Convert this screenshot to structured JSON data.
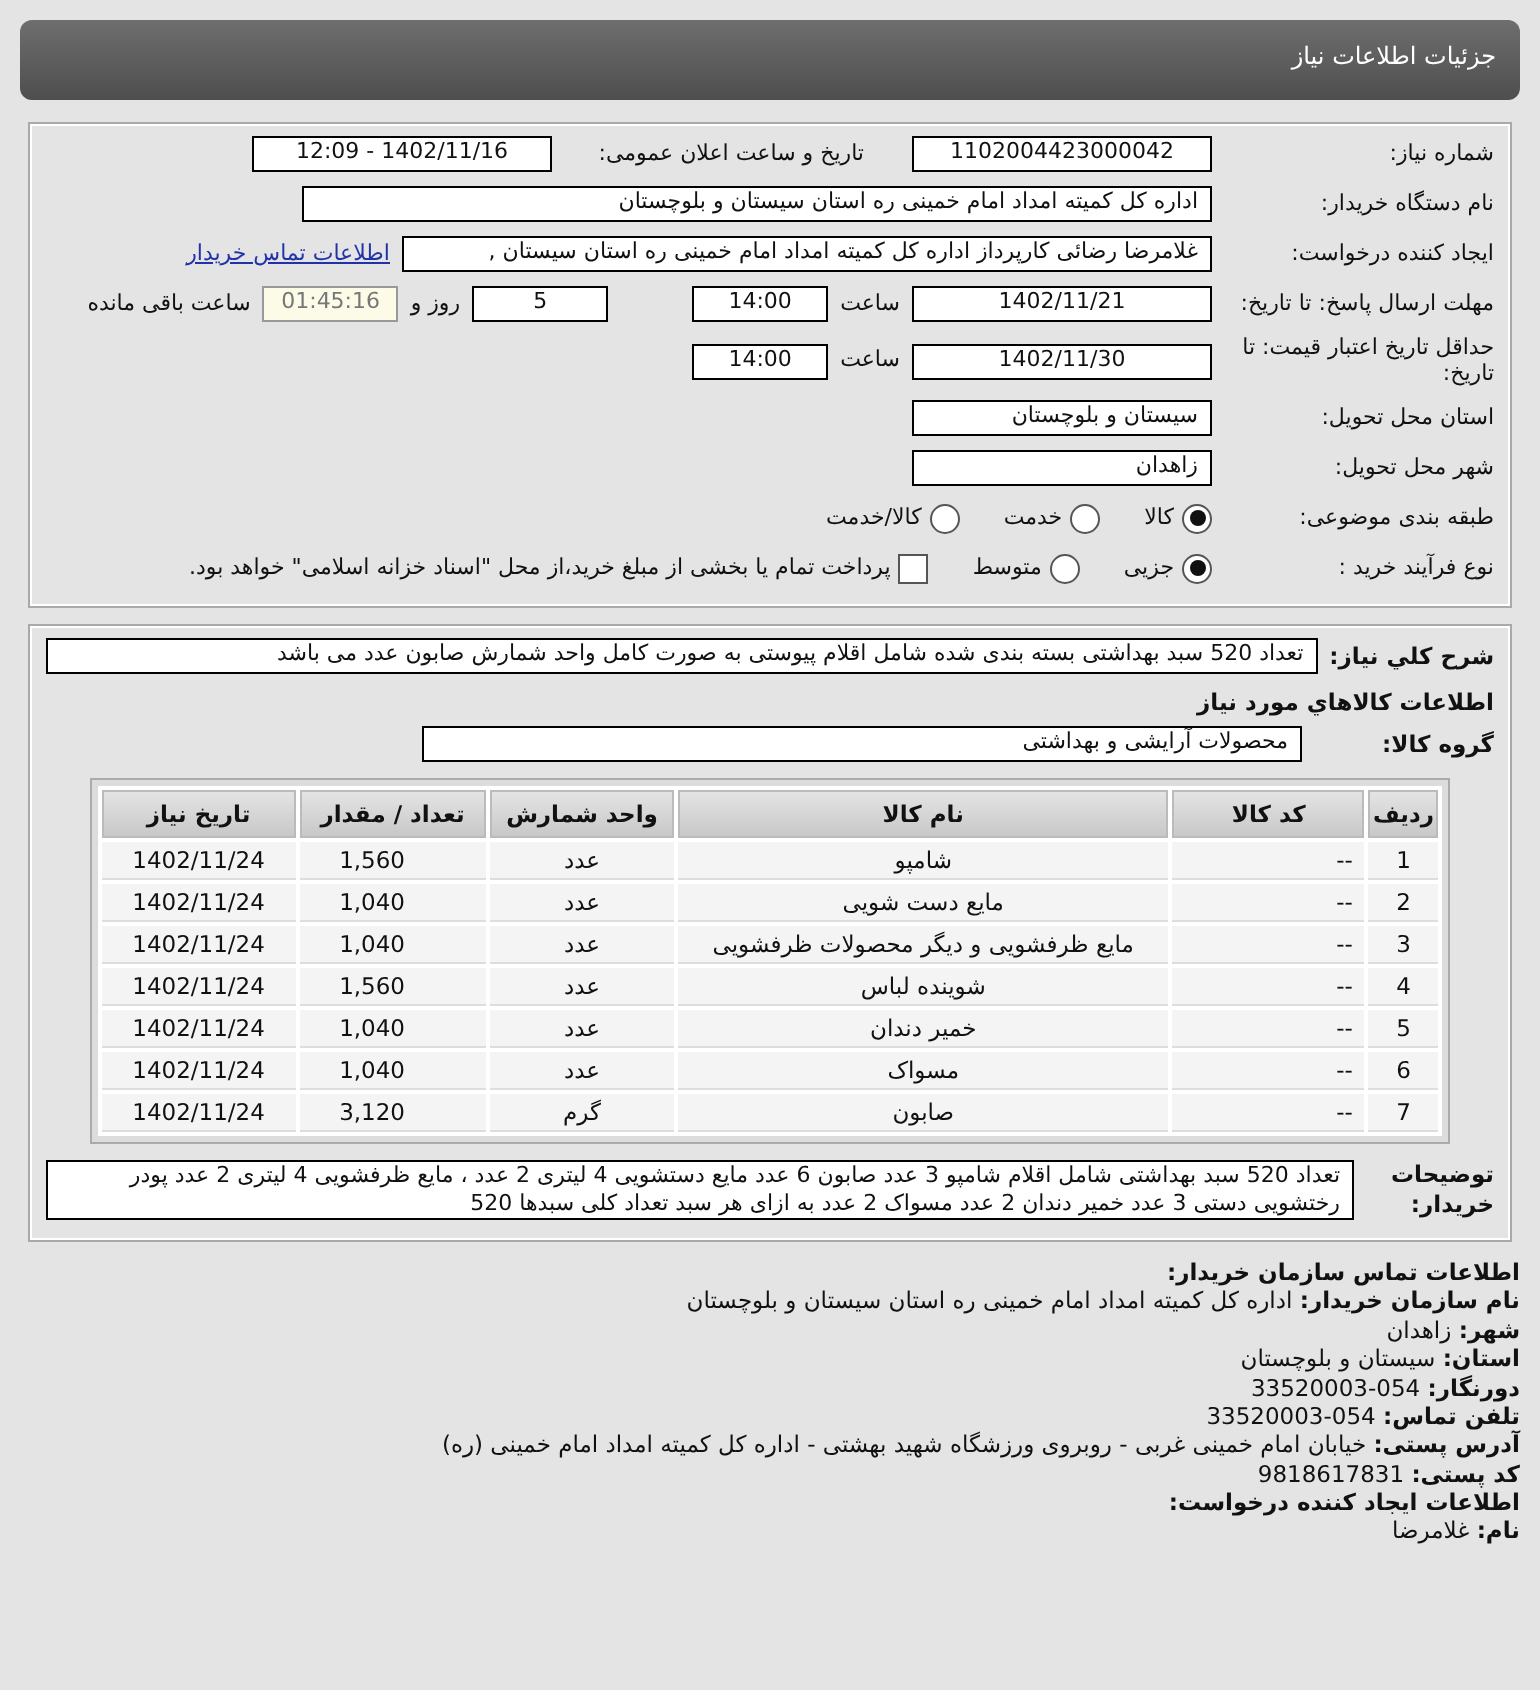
{
  "header": {
    "title": "جزئیات اطلاعات نیاز"
  },
  "need_number": {
    "label": "شماره نیاز:",
    "value": "1102004423000042"
  },
  "announce": {
    "label": "تاریخ و ساعت اعلان عمومی:",
    "value": "1402/11/16 - 12:09"
  },
  "buyer_org": {
    "label": "نام دستگاه خریدار:",
    "value": "اداره کل کمیته امداد امام خمینی  ره  استان سیستان و بلوچستان"
  },
  "creator": {
    "label": "ایجاد کننده درخواست:",
    "value": "غلامرضا رضائی کارپرداز اداره کل کمیته امداد امام خمینی  ره  استان سیستان ,",
    "link": "اطلاعات تماس خریدار"
  },
  "reply_deadline": {
    "label": "مهلت ارسال پاسخ: تا تاریخ:",
    "date": "1402/11/21",
    "time_label": "ساعت",
    "time": "14:00",
    "days": "5",
    "days_label": "روز و",
    "remaining": "01:45:16",
    "remaining_label": "ساعت باقی مانده"
  },
  "price_validity": {
    "label": "حداقل تاریخ اعتبار قیمت: تا تاریخ:",
    "date": "1402/11/30",
    "time_label": "ساعت",
    "time": "14:00"
  },
  "delivery_province": {
    "label": "استان محل تحویل:",
    "value": "سیستان و بلوچستان"
  },
  "delivery_city": {
    "label": "شهر محل تحویل:",
    "value": "زاهدان"
  },
  "category": {
    "label": "طبقه بندی موضوعی:",
    "options": [
      {
        "label": "کالا",
        "selected": true
      },
      {
        "label": "خدمت",
        "selected": false
      },
      {
        "label": "کالا/خدمت",
        "selected": false
      }
    ]
  },
  "process": {
    "label": "نوع فرآیند خرید :",
    "options": [
      {
        "label": "جزیی",
        "selected": true
      },
      {
        "label": "متوسط",
        "selected": false
      }
    ],
    "payment": {
      "label": "پرداخت تمام یا بخشی از مبلغ خرید،از محل \"اسناد خزانه اسلامی\" خواهد بود.",
      "checked": false
    }
  },
  "summary": {
    "label": "شرح کلي نياز:",
    "value": "تعداد 520 سبد بهداشتی بسته بندی شده شامل اقلام پیوستی به صورت کامل واحد شمارش صابون عدد می باشد"
  },
  "goods_title": "اطلاعات کالاهاي مورد نياز",
  "goods_group": {
    "label": "گروه کالا:",
    "value": "محصولات آرایشی و بهداشتی"
  },
  "table": {
    "columns": [
      "ردیف",
      "کد کالا",
      "نام کالا",
      "واحد شمارش",
      "تعداد / مقدار",
      "تاریخ نیاز"
    ],
    "rows": [
      [
        "1",
        "--",
        "شامپو",
        "عدد",
        "1,560",
        "1402/11/24"
      ],
      [
        "2",
        "--",
        "مایع دست شویی",
        "عدد",
        "1,040",
        "1402/11/24"
      ],
      [
        "3",
        "--",
        "مایع ظرفشویی و دیگر محصولات ظرفشویی",
        "عدد",
        "1,040",
        "1402/11/24"
      ],
      [
        "4",
        "--",
        "شوینده لباس",
        "عدد",
        "1,560",
        "1402/11/24"
      ],
      [
        "5",
        "--",
        "خمیر دندان",
        "عدد",
        "1,040",
        "1402/11/24"
      ],
      [
        "6",
        "--",
        "مسواک",
        "عدد",
        "1,040",
        "1402/11/24"
      ],
      [
        "7",
        "--",
        "صابون",
        "گرم",
        "3,120",
        "1402/11/24"
      ]
    ]
  },
  "buyer_notes": {
    "label": "توضیحات خریدار:",
    "value": "تعداد 520 سبد بهداشتی شامل اقلام شامپو 3 عدد صابون 6 عدد مایع دستشویی 4 لیتری 2 عدد ، مایع ظرفشویی 4 لیتری 2 عدد پودر رختشویی دستی 3 عدد خمیر دندان 2 عدد مسواک 2 عدد به ازای هر سبد تعداد کلی سبدها 520"
  },
  "contact": {
    "title": "اطلاعات تماس سازمان خریدار:",
    "fields": [
      {
        "label": "نام سازمان خریدار:",
        "value": "اداره کل کمیته امداد امام خمینی ره استان سیستان و بلوچستان"
      },
      {
        "label": "شهر:",
        "value": "زاهدان"
      },
      {
        "label": "استان:",
        "value": "سیستان و بلوچستان"
      },
      {
        "label": "دورنگار:",
        "value": "054-33520003"
      },
      {
        "label": "تلفن تماس:",
        "value": "054-33520003"
      },
      {
        "label": "آدرس پستی:",
        "value": "خیابان امام خمینی غربی - روبروی ورزشگاه شهید بهشتی - اداره کل کمیته امداد امام خمینی (ره)"
      },
      {
        "label": "کد پستی:",
        "value": "9818617831"
      }
    ]
  },
  "creator_info": {
    "title": "اطلاعات ایجاد کننده درخواست:",
    "fields": [
      {
        "label": "نام:",
        "value": "غلامرضا"
      }
    ]
  }
}
